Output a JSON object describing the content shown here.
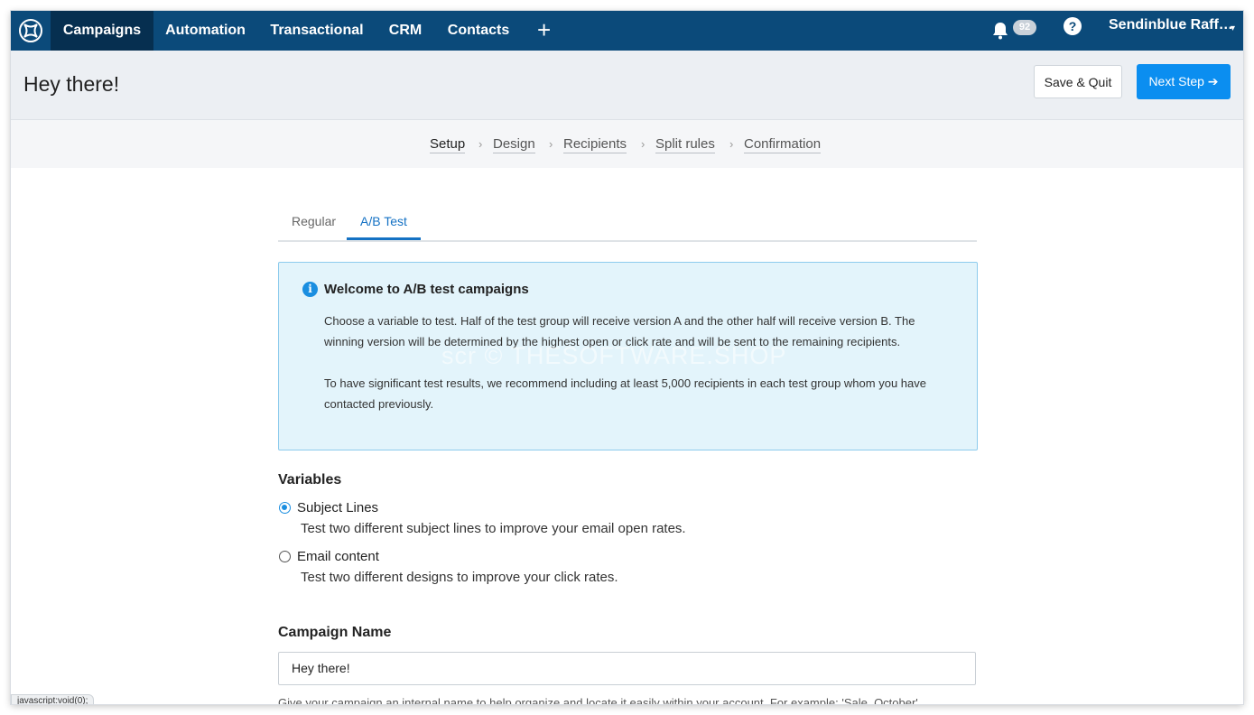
{
  "nav": {
    "items": [
      "Campaigns",
      "Automation",
      "Transactional",
      "CRM",
      "Contacts"
    ],
    "plus": "+",
    "notification_count": "92",
    "help": "?",
    "account": "Sendinblue Raff…",
    "caret": "▾"
  },
  "header": {
    "title": "Hey there!",
    "save_label": "Save & Quit",
    "next_label": "Next Step ➔"
  },
  "steps": {
    "items": [
      "Setup",
      "Design",
      "Recipients",
      "Split rules",
      "Confirmation"
    ],
    "separator": "›"
  },
  "tabs": [
    "Regular",
    "A/B Test"
  ],
  "info": {
    "icon": "i",
    "title": "Welcome to A/B test campaigns",
    "p1": "Choose a variable to test. Half of the test group will receive version A and the other half will receive version B. The winning version will be determined by the highest open or click rate and will be sent to the remaining recipients.",
    "p2": "To have significant test results, we recommend including at least 5,000 recipients in each test group whom you have contacted previously.",
    "watermark": "scr © THESOFTWARE.SHOP"
  },
  "variables": {
    "label": "Variables",
    "options": [
      {
        "label": "Subject Lines",
        "desc": "Test two different subject lines to improve your email open rates.",
        "checked": true
      },
      {
        "label": "Email content",
        "desc": "Test two different designs to improve your click rates.",
        "checked": false
      }
    ]
  },
  "campaign_name": {
    "label": "Campaign Name",
    "value": "Hey there!",
    "helper": "Give your campaign an internal name to help organize and locate it easily within your account. For example: 'Sale_October'"
  },
  "statusbar": "javascript:void(0);",
  "colors": {
    "nav_bg": "#0b4a7a",
    "nav_active": "#062f50",
    "primary": "#0b8ef0",
    "info_bg": "#e3f4fb",
    "info_border": "#8dcbed"
  }
}
